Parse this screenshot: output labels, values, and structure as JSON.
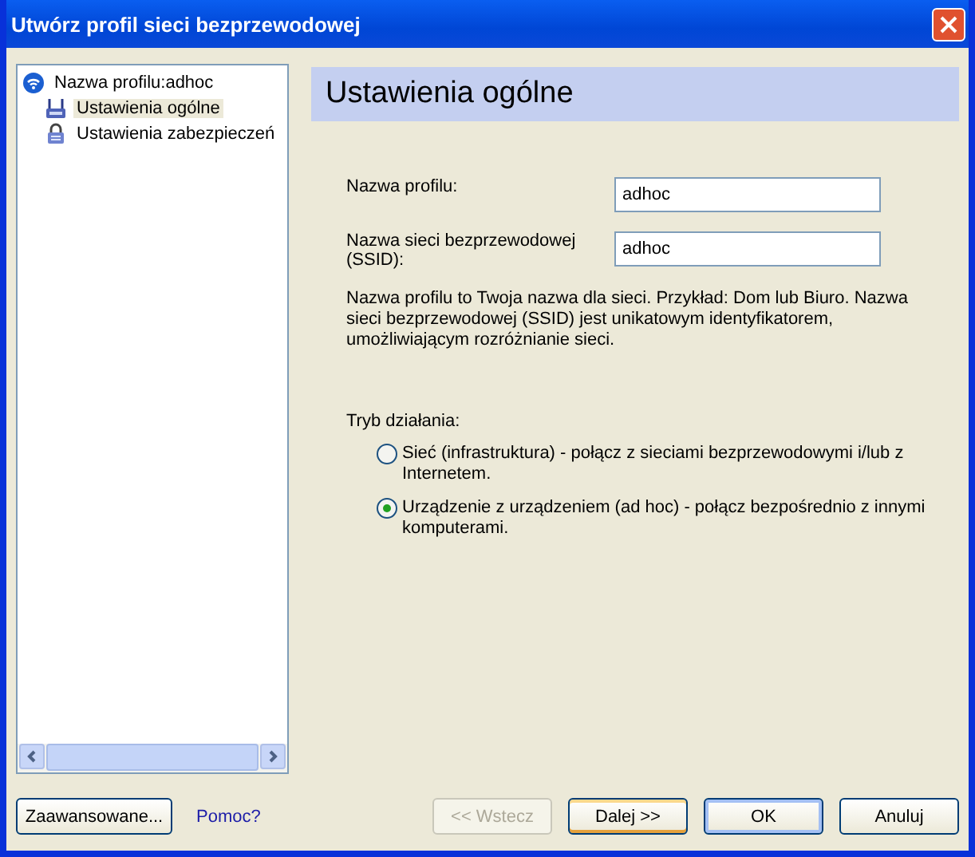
{
  "window": {
    "title": "Utwórz profil sieci bezprzewodowej"
  },
  "tree": {
    "label": "Nazwa profilu:adhoc",
    "children": [
      {
        "label": "Ustawienia ogólne",
        "kind": "general",
        "selected": true
      },
      {
        "label": "Ustawienia zabezpieczeń",
        "kind": "security",
        "selected": false
      }
    ]
  },
  "header": "Ustawienia ogólne",
  "fields": [
    {
      "label": "Nazwa profilu:",
      "value": "adhoc"
    },
    {
      "label": "Nazwa sieci bezprzewodowej (SSID):",
      "value": "adhoc"
    }
  ],
  "description": "Nazwa profilu to Twoja nazwa dla sieci. Przykład: Dom lub Biuro. Nazwa sieci bezprzewodowej (SSID) jest unikatowym identyfikatorem, umożliwiającym rozróżnianie sieci.",
  "mode": {
    "label": "Tryb działania:",
    "options": [
      {
        "label": "Sieć (infrastruktura) - połącz z sieciami bezprzewodowymi i/lub z Internetem.",
        "selected": false
      },
      {
        "label": "Urządzenie z urządzeniem (ad hoc) - połącz bezpośrednio z innymi komputerami.",
        "selected": true
      }
    ]
  },
  "advanced_button": "Zaawansowane...",
  "help_link": "Pomoc?",
  "buttons": [
    {
      "label": "<< Wstecz",
      "disabled": true,
      "kind": "normal"
    },
    {
      "label": "Dalej >>",
      "disabled": false,
      "kind": "focused"
    },
    {
      "label": "OK",
      "disabled": false,
      "kind": "default"
    },
    {
      "label": "Anuluj",
      "disabled": false,
      "kind": "normal"
    }
  ]
}
